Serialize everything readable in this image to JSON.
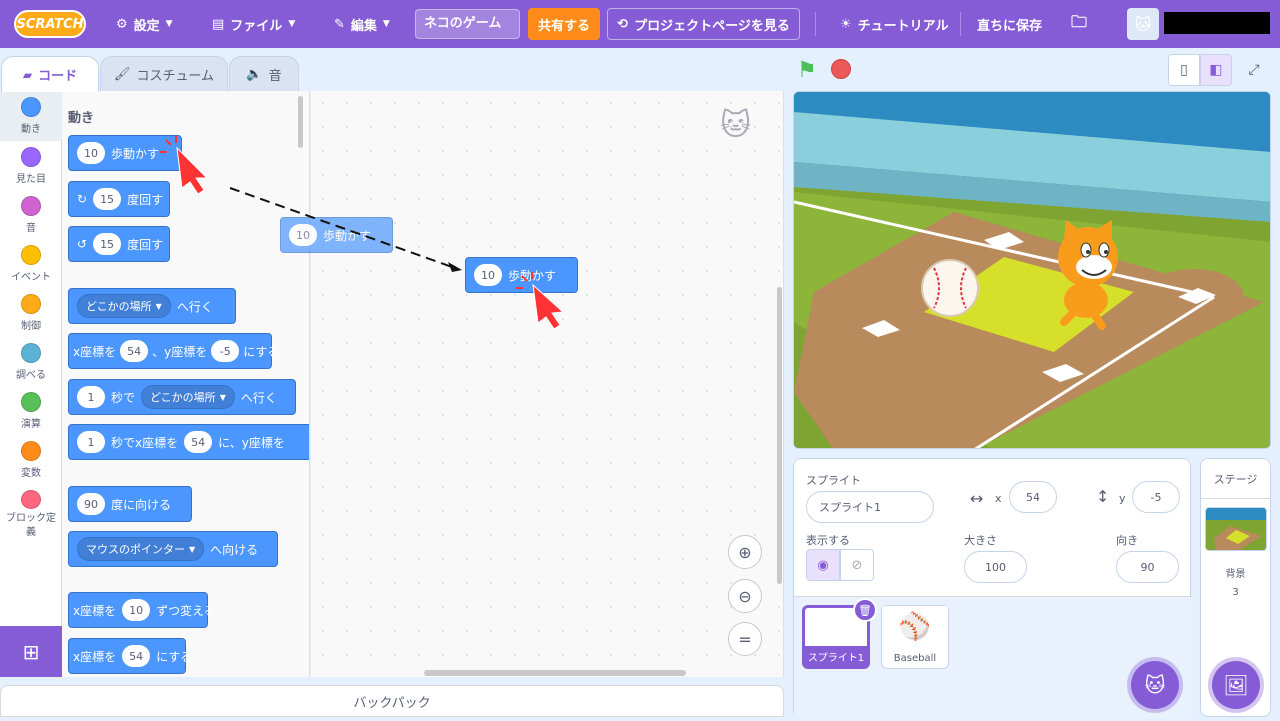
{
  "topbar": {
    "logo": "SCRATCH",
    "menus": [
      {
        "label": "設定"
      },
      {
        "label": "ファイル"
      },
      {
        "label": "編集"
      }
    ],
    "project_title": "ネコのゲーム",
    "share_label": "共有する",
    "project_page_label": "プロジェクトページを見る",
    "tutorial_label": "チュートリアル",
    "save_now_label": "直ちに保存"
  },
  "tabs": [
    "コード",
    "コスチューム",
    "音"
  ],
  "categories": [
    {
      "label": "動き",
      "color": "#4c97ff"
    },
    {
      "label": "見た目",
      "color": "#9966ff"
    },
    {
      "label": "音",
      "color": "#cf63cf"
    },
    {
      "label": "イベント",
      "color": "#ffbf00"
    },
    {
      "label": "制御",
      "color": "#ffab19"
    },
    {
      "label": "調べる",
      "color": "#5cb1d6"
    },
    {
      "label": "演算",
      "color": "#59c059"
    },
    {
      "label": "変数",
      "color": "#ff8c1a"
    },
    {
      "label": "ブロック定義",
      "color": "#ff6680"
    }
  ],
  "palette": {
    "heading": "動き",
    "blocks": {
      "move": {
        "num": "10",
        "text": "歩動かす"
      },
      "turn_right": {
        "num": "15",
        "text": "度回す"
      },
      "turn_left": {
        "num": "15",
        "text": "度回す"
      },
      "goto": {
        "dd": "どこかの場所",
        "text": "へ行く"
      },
      "gotoxy": {
        "t1": "x座標を",
        "x": "54",
        "t2": "、y座標を",
        "y": "-5",
        "t3": "にする"
      },
      "glide": {
        "num": "1",
        "t1": "秒で",
        "dd": "どこかの場所",
        "t2": "へ行く"
      },
      "glidexy": {
        "num": "1",
        "t1": "秒でx座標を",
        "x": "54",
        "t2": "に、y座標を"
      },
      "point_dir": {
        "num": "90",
        "text": "度に向ける"
      },
      "point_towards": {
        "dd": "マウスのポインター",
        "text": "へ向ける"
      },
      "change_x": {
        "t1": "x座標を",
        "num": "10",
        "t2": "ずつ変える"
      },
      "set_x": {
        "t1": "x座標を",
        "num": "54",
        "t2": "にする"
      }
    }
  },
  "script": {
    "ghost_block": {
      "num": "10",
      "text": "歩動かす"
    },
    "dropped_block": {
      "num": "10",
      "text": "歩動かす"
    }
  },
  "backpack_label": "バックパック",
  "sprite_info": {
    "sprite_label": "スプライト",
    "sprite_name": "スプライト1",
    "x_label": "x",
    "x_value": "54",
    "y_label": "y",
    "y_value": "-5",
    "show_label": "表示する",
    "size_label": "大きさ",
    "size_value": "100",
    "direction_label": "向き",
    "direction_value": "90"
  },
  "sprites": [
    {
      "name": "スプライト1",
      "icon": "cat-icon"
    },
    {
      "name": "Baseball",
      "icon": "baseball-icon"
    }
  ],
  "stage_pane": {
    "title": "ステージ",
    "backdrop_label": "背景",
    "backdrop_count": "3"
  }
}
